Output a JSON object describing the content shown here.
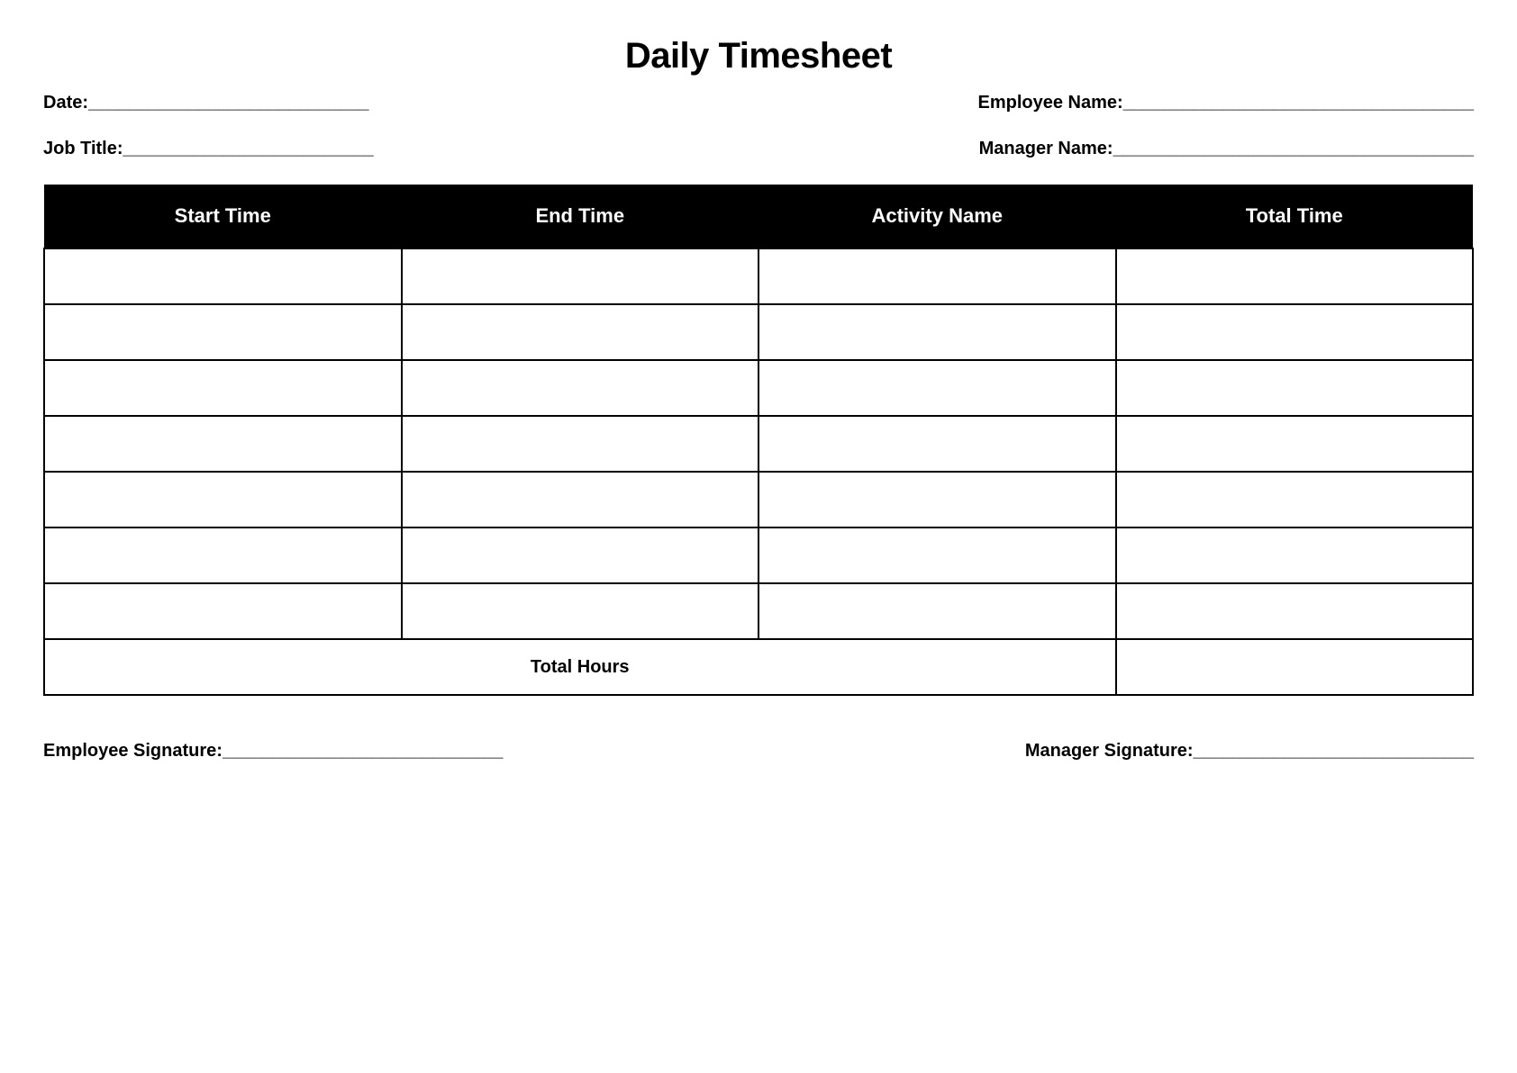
{
  "title": "Daily Timesheet",
  "fields": {
    "date_label": "Date: ",
    "date_line": "____________________________",
    "employee_name_label": "Employee Name: ",
    "employee_name_line": "___________________________________",
    "job_title_label": "Job Title:",
    "job_title_line": "_________________________",
    "manager_name_label": "Manager Name: ",
    "manager_name_line": "____________________________________"
  },
  "table": {
    "headers": [
      "Start Time",
      "End Time",
      "Activity Name",
      "Total Time"
    ],
    "rows": [
      [
        "",
        "",
        "",
        ""
      ],
      [
        "",
        "",
        "",
        ""
      ],
      [
        "",
        "",
        "",
        ""
      ],
      [
        "",
        "",
        "",
        ""
      ],
      [
        "",
        "",
        "",
        ""
      ],
      [
        "",
        "",
        "",
        ""
      ],
      [
        "",
        "",
        "",
        ""
      ]
    ],
    "total_label": "Total Hours",
    "total_value": ""
  },
  "signatures": {
    "employee_label": "Employee Signature:",
    "employee_line": "____________________________",
    "manager_label": "Manager Signature:",
    "manager_line": "____________________________"
  }
}
